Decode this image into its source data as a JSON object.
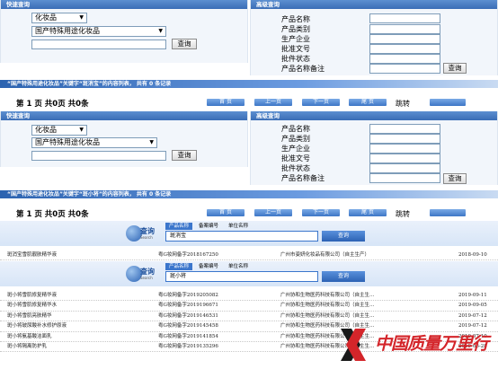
{
  "form1": {
    "quick_title": "快速查询",
    "adv_title": "高级查询",
    "category_select": "化妆品",
    "type_select": "国产特殊用途化妆品",
    "search_button": "查询",
    "adv_labels": [
      "产品名称",
      "产品类别",
      "生产企业",
      "批准文号",
      "批件状态",
      "产品名称备注"
    ]
  },
  "result1": "“国产特殊用途化妆品”关键字“斑消宝”的内容列表， 共有 0 条记录",
  "pager1": {
    "info": "第 1 页 共0页 共0条",
    "first": "首 页",
    "prev": "上一页",
    "next": "下一页",
    "last": "尾 页",
    "jump": "跳转"
  },
  "form2": {
    "quick_title": "快速查询",
    "adv_title": "高级查询",
    "category_select": "化妆品",
    "type_select": "国产特殊用途化妆品",
    "search_button": "查询",
    "adv_labels": [
      "产品名称",
      "产品类别",
      "生产企业",
      "批准文号",
      "批件状态",
      "产品名称备注"
    ]
  },
  "result2": "“国产特殊用途化妆品”关键字“斑小将”的内容列表， 共有 0 条记录",
  "pager2": {
    "info": "第 1 页 共0页 共0条",
    "first": "首 页",
    "prev": "上一页",
    "next": "下一页",
    "last": "尾 页",
    "jump": "跳转"
  },
  "search1": {
    "logo_cn": "查询",
    "logo_en": "Search",
    "tabs": [
      "产品名称",
      "备案编号",
      "单位名称"
    ],
    "value": "斑消宝",
    "button": "查询"
  },
  "record1": {
    "name": "斑消宝雪肌靓肤精华液",
    "code": "粤G妆网备字2018167250",
    "company": "广州市姿妍化妆品有限公司（自主生产）",
    "date": "2018-09-10"
  },
  "search2": {
    "logo_cn": "查询",
    "logo_en": "Search",
    "tabs": [
      "产品名称",
      "备案编号",
      "单位名称"
    ],
    "value": "斑小将",
    "button": "查询"
  },
  "records2": [
    {
      "name": "斑小将雪肌修复精华液",
      "code": "粤G妆网备字2019205082",
      "company": "广州协和生物医药科技有限公司（自主生…",
      "date": "2019-09-11"
    },
    {
      "name": "斑小将雪肌修复精华水",
      "code": "粤G妆网备字2019196671",
      "company": "广州协和生物医药科技有限公司（自主生…",
      "date": "2019-09-05"
    },
    {
      "name": "斑小将雪肌亮肤精华",
      "code": "粤G妆网备字2019146531",
      "company": "广州协和生物医药科技有限公司（自主生…",
      "date": "2019-07-12"
    },
    {
      "name": "斑小将玻尿酸补水修护原液",
      "code": "粤G妆网备字2019145458",
      "company": "广州协和生物医药科技有限公司（自主生…",
      "date": "2019-07-12"
    },
    {
      "name": "斑小将氨基酸洁面乳",
      "code": "粤G妆网备字2019141854",
      "company": "广州协和生物医药科技有限公司（自主生…",
      "date": "2019-07-10"
    },
    {
      "name": "斑小将隔离防护乳",
      "code": "粤G妆网备字2019135296",
      "company": "广州协和生物医药科技有限公司（自主生…",
      "date": "2019-06-28"
    }
  ],
  "watermark": "中国质量万里行",
  "colors": {
    "header_blue": "#3a6db6",
    "panel": "#f2f6fb",
    "watermark_red": "#d4252a"
  }
}
